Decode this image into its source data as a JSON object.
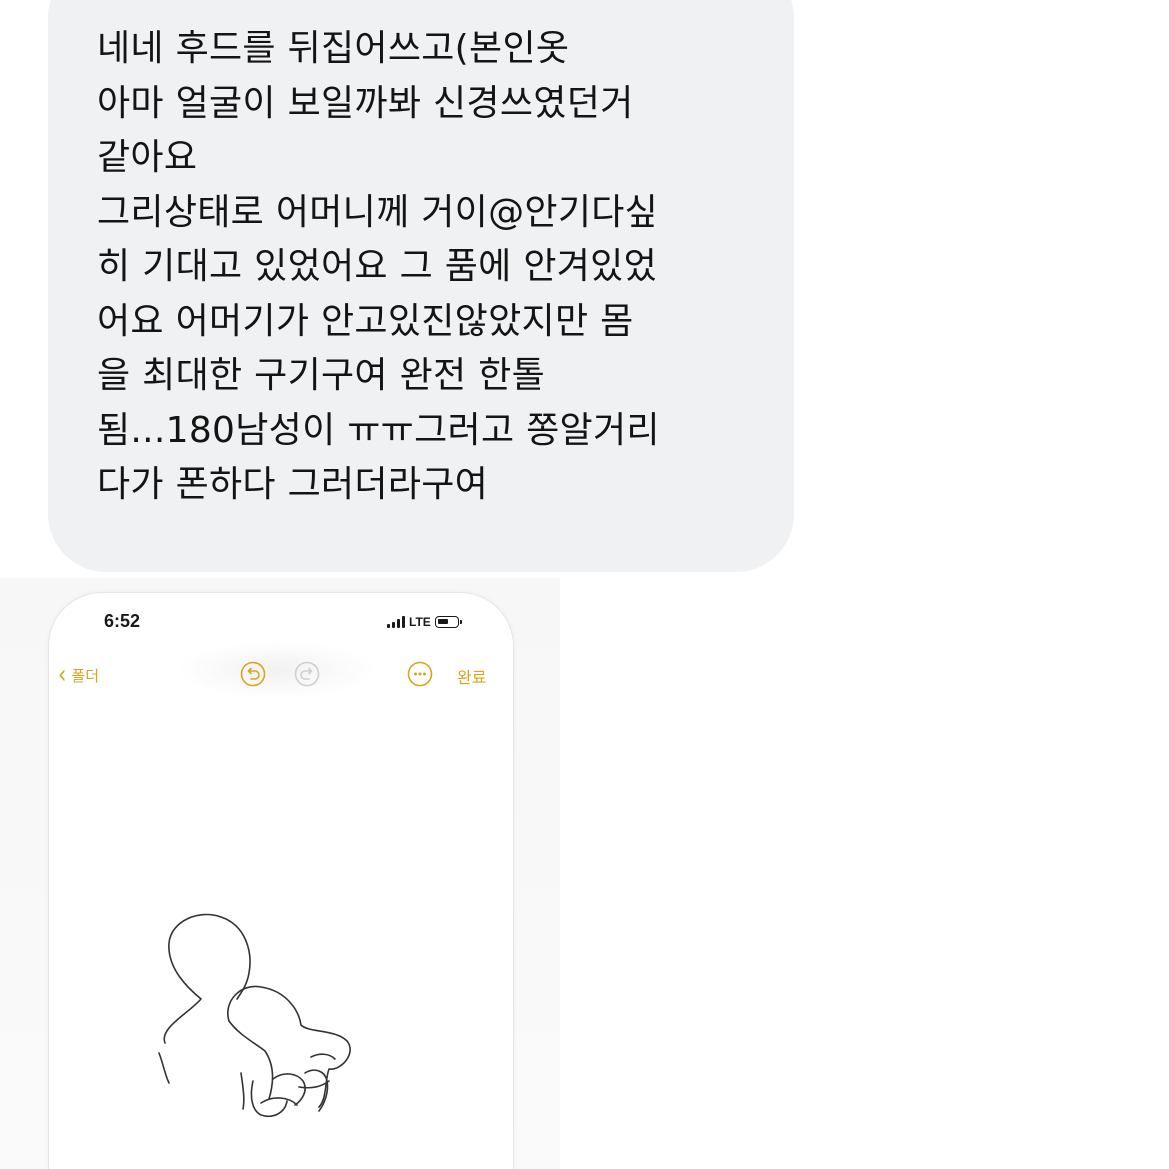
{
  "message": {
    "lines": [
      "네네 후드를 뒤집어쓰고(본인옷",
      "아마 얼굴이 보일까봐 신경쓰였던거",
      "같아요",
      "그리상태로 어머니께 거이@안기다싶",
      "히 기대고 있었어요 그 품에 안겨있었",
      "어요 어머기가 안고있진않았지만 몸",
      "을 최대한 구기구여 완전 한톨",
      "됨...180남성이 ㅠㅠ그러고 쫑알거리",
      "다가 폰하다 그러더라구여"
    ]
  },
  "phone_screenshot": {
    "status_bar": {
      "time": "6:52",
      "network": "LTE"
    },
    "toolbar": {
      "back_label": "폴더",
      "done_label": "완료",
      "icons": [
        "undo-icon",
        "redo-icon",
        "more-icon"
      ]
    },
    "accent_color": "#d9a520",
    "drawing": {
      "description_icon": "sketch-drawing"
    }
  }
}
